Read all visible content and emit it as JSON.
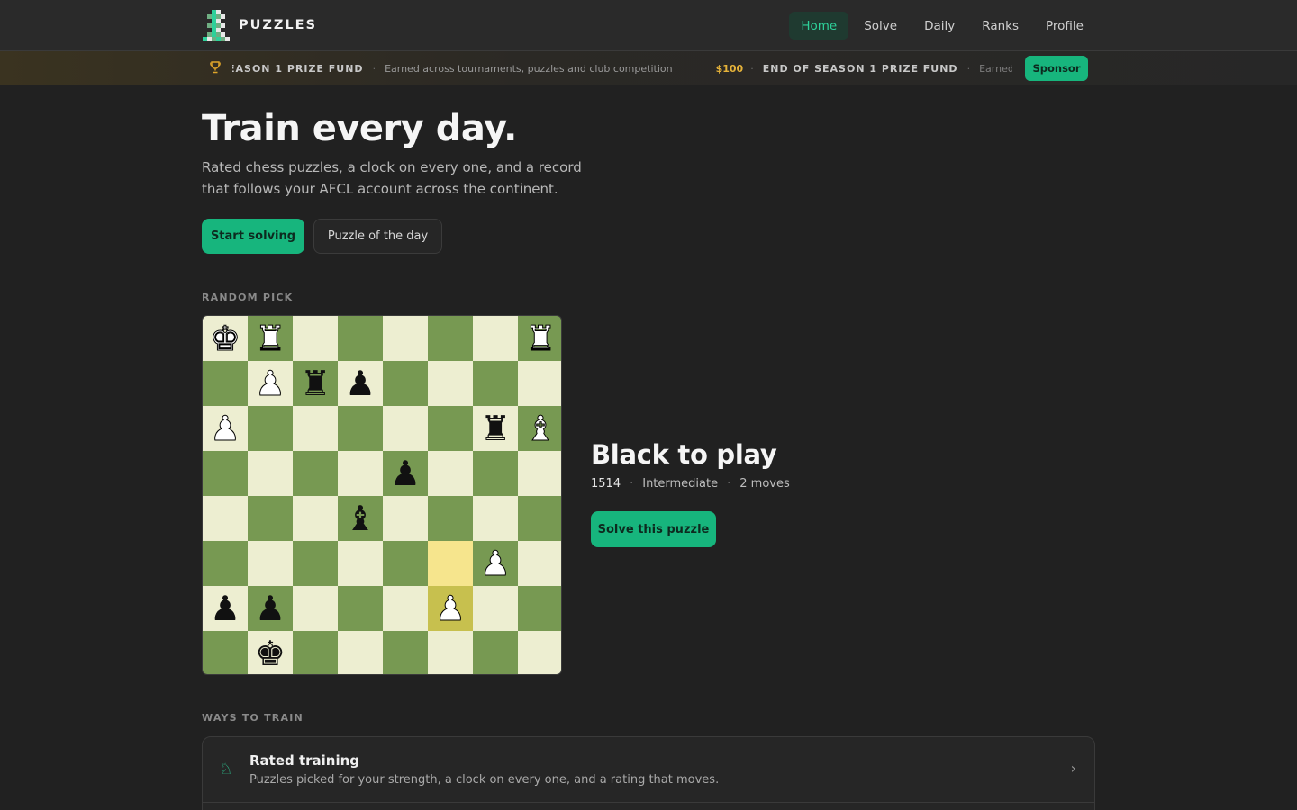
{
  "brand": {
    "name": "PUZZLES",
    "logo_icon": "chess-pawn-pixel-logo"
  },
  "nav": {
    "items": [
      {
        "label": "Home",
        "active": true
      },
      {
        "label": "Solve",
        "active": false
      },
      {
        "label": "Daily",
        "active": false
      },
      {
        "label": "Ranks",
        "active": false
      },
      {
        "label": "Profile",
        "active": false
      }
    ]
  },
  "ticker": {
    "icon": "trophy-icon",
    "entries": [
      {
        "amount": "",
        "title": "EASON 1 PRIZE FUND",
        "desc": "Earned across tournaments, puzzles and club competition"
      },
      {
        "amount": "$100",
        "title": "END OF SEASON 1 PRIZE FUND",
        "desc": "Earned across"
      }
    ],
    "sponsor_label": "Sponsor"
  },
  "hero": {
    "title": "Train every day.",
    "subtitle": "Rated chess puzzles, a clock on every one, and a record that follows your AFCL account across the continent.",
    "primary_cta": "Start solving",
    "secondary_cta": "Puzzle of the day"
  },
  "random_pick": {
    "section_label": "RANDOM PICK",
    "board": [
      [
        "wK",
        "wR",
        "",
        "",
        "",
        "",
        "",
        "wR"
      ],
      [
        "",
        "wP",
        "bR",
        "bP",
        "",
        "",
        "",
        ""
      ],
      [
        "wP",
        "",
        "",
        "",
        "",
        "",
        "bR",
        "wB"
      ],
      [
        "",
        "",
        "",
        "",
        "bP",
        "",
        "",
        ""
      ],
      [
        "",
        "",
        "",
        "bB",
        "",
        "",
        "",
        ""
      ],
      [
        "",
        "",
        "",
        "",
        "",
        "",
        "wP",
        ""
      ],
      [
        "bP",
        "bP",
        "",
        "",
        "",
        "wP",
        "",
        ""
      ],
      [
        "",
        "bK",
        "",
        "",
        "",
        "",
        "",
        ""
      ]
    ],
    "highlighted_squares": [
      [
        5,
        5
      ],
      [
        6,
        5
      ]
    ],
    "title": "Black to play",
    "rating": "1514",
    "level": "Intermediate",
    "moves": "2 moves",
    "cta": "Solve this puzzle"
  },
  "ways_to_train": {
    "section_label": "WAYS TO TRAIN",
    "items": [
      {
        "icon": "knight-icon",
        "title": "Rated training",
        "desc": "Puzzles picked for your strength, a clock on every one, and a rating that moves."
      }
    ]
  },
  "colors": {
    "accent": "#17b57d",
    "accent_text": "#2ed19a",
    "background": "#212121",
    "board_light": "#edeed1",
    "board_dark": "#779952",
    "gold": "#e5b23a"
  }
}
